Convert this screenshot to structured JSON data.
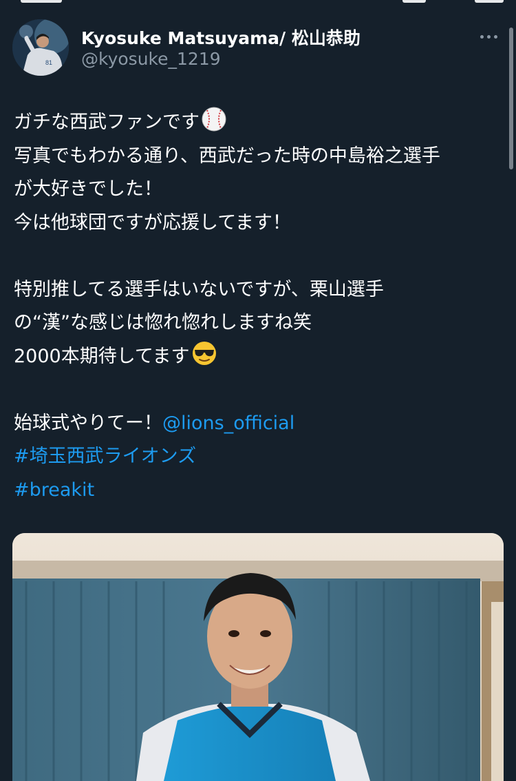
{
  "status_bar": {
    "visible": "partially clipped"
  },
  "tweet": {
    "author": {
      "display_name": "Kyosuke Matsuyama/ 松山恭助",
      "handle": "@kyosuke_1219",
      "avatar_icon": "profile-photo-baseball-uniform"
    },
    "more_icon": "more-horizontal-icon",
    "lines": [
      {
        "text": "ガチな西武ファンです",
        "emoji": "baseball-emoji"
      },
      {
        "text": "写真でもわかる通り、西武だった時の中島裕之選手"
      },
      {
        "text": "が大好きでした！"
      },
      {
        "text": "今は他球団ですが応援してます！"
      },
      {
        "text": ""
      },
      {
        "text": "特別推してる選手はいないですが、栗山選手"
      },
      {
        "text": "の“漢”な感じは惚れ惚れしますね笑"
      },
      {
        "text": "2000本期待してます",
        "emoji": "sunglasses-emoji"
      },
      {
        "text": ""
      },
      {
        "text": "始球式やりてー！",
        "mention": "@lions_official"
      }
    ],
    "hashtags": [
      "#埼玉西武ライオンズ",
      "#breakit"
    ],
    "media": {
      "description_icon": "photo-young-man-in-lions-jersey"
    }
  },
  "colors": {
    "background": "#15202b",
    "text_primary": "#ffffff",
    "text_secondary": "#8b98a5",
    "link": "#1d9bf0"
  }
}
